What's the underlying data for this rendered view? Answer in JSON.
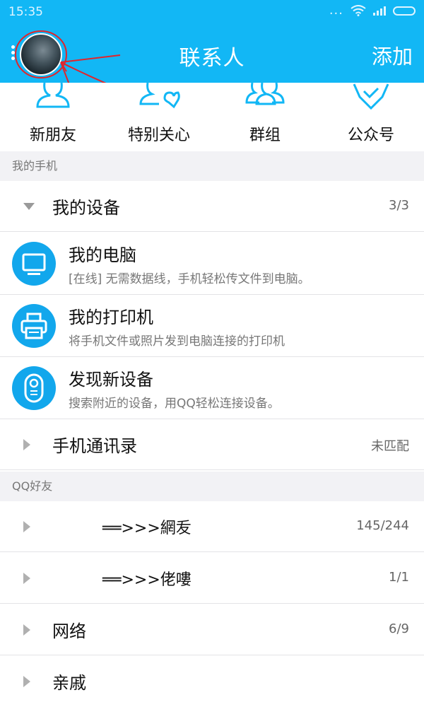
{
  "status_bar": {
    "time": "15:35",
    "dots": "...",
    "icons": [
      "wifi-icon",
      "signal-icon",
      "battery-icon"
    ]
  },
  "header": {
    "title": "联系人",
    "add_label": "添加",
    "colors": {
      "background": "#12b7f5",
      "text": "#ffffff",
      "annotation": "#e0252c"
    }
  },
  "quick_actions": [
    {
      "label": "新朋友",
      "icon": "new-friends-icon"
    },
    {
      "label": "特别关心",
      "icon": "special-care-icon"
    },
    {
      "label": "群组",
      "icon": "groups-icon"
    },
    {
      "label": "公众号",
      "icon": "official-accounts-icon"
    }
  ],
  "my_phone": {
    "section_label": "我的手机",
    "devices_group": {
      "name": "我的设备",
      "count": "3/3",
      "expanded": true
    },
    "devices": [
      {
        "title": "我的电脑",
        "desc": "[在线] 无需数据线，手机轻松传文件到电脑。",
        "icon": "computer-icon"
      },
      {
        "title": "我的打印机",
        "desc": "将手机文件或照片发到电脑连接的打印机",
        "icon": "printer-icon"
      },
      {
        "title": "发现新设备",
        "desc": "搜索附近的设备，用QQ轻松连接设备。",
        "icon": "new-device-icon"
      }
    ],
    "contacts_group": {
      "name": "手机通讯录",
      "count": "未匹配"
    }
  },
  "qq_friends": {
    "section_label": "QQ好友",
    "groups": [
      {
        "name": "══>>>網叐",
        "count": "145/244"
      },
      {
        "name": "══>>>佬嘍",
        "count": "1/1"
      },
      {
        "name": "网络",
        "count": "6/9"
      },
      {
        "name": "亲戚",
        "count": ""
      }
    ]
  }
}
